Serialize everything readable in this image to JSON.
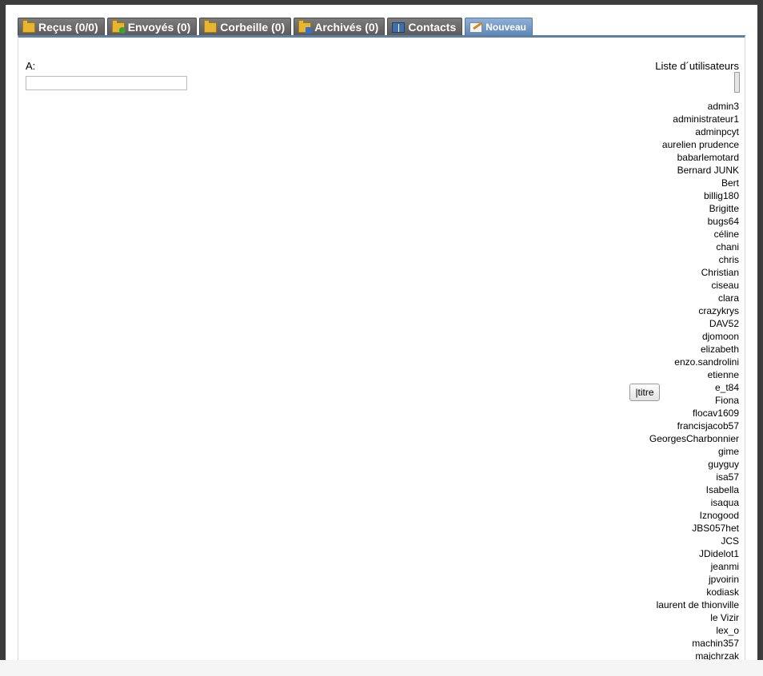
{
  "tabs": [
    {
      "label": "Reçus (0/0)",
      "icon": "inbox-folder-icon"
    },
    {
      "label": "Envoyés (0)",
      "icon": "sent-folder-icon"
    },
    {
      "label": "Corbeille (0)",
      "icon": "trash-folder-icon"
    },
    {
      "label": "Archivés (0)",
      "icon": "archive-folder-icon"
    },
    {
      "label": "Contacts",
      "icon": "contacts-book-icon"
    },
    {
      "label": "Nouveau",
      "icon": "new-message-icon",
      "active": true
    }
  ],
  "compose": {
    "to_label": "A:",
    "to_value": "",
    "title_button": "|titre"
  },
  "users": {
    "label": "Liste d´utilisateurs",
    "items": [
      "admin3",
      "administrateur1",
      "adminpcyt",
      "aurelien prudence",
      "babarlemotard",
      "Bernard JUNK",
      "Bert",
      "billig180",
      "Brigitte",
      "bugs64",
      "céline",
      "chani",
      "chris",
      "Christian",
      "ciseau",
      "clara",
      "crazykrys",
      "DAV52",
      "djomoon",
      "elizabeth",
      "enzo.sandrolini",
      "etienne",
      "e_t84",
      "Fiona",
      "flocav1609",
      "francisjacob57",
      "GeorgesCharbonnier",
      "gime",
      "guyguy",
      "isa57",
      "Isabella",
      "isaqua",
      "Iznogood",
      "JBS057het",
      "JCS",
      "JDidelot1",
      "jeanmi",
      "jpvoirin",
      "kodiask",
      "laurent de thionville",
      "le Vizir",
      "lex_o",
      "machin357",
      "majchrzak"
    ]
  },
  "colors": {
    "tab_bg": "#6b6b6b",
    "tab_active_bg": "#7199c6",
    "accent_border": "#5b7fa6"
  }
}
